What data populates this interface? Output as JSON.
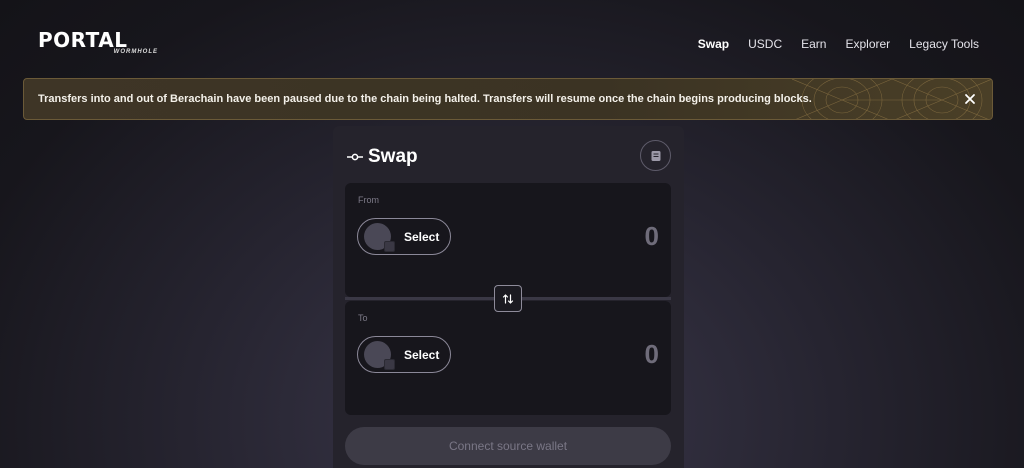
{
  "header": {
    "logo": {
      "name": "PORTAL",
      "sub": "WORMHOLE"
    },
    "nav": [
      {
        "label": "Swap",
        "active": true
      },
      {
        "label": "USDC",
        "active": false
      },
      {
        "label": "Earn",
        "active": false
      },
      {
        "label": "Explorer",
        "active": false
      },
      {
        "label": "Legacy Tools",
        "active": false
      }
    ]
  },
  "banner": {
    "message": "Transfers into and out of Berachain have been paused due to the chain being halted. Transfers will resume once the chain begins producing blocks.",
    "close_icon": "close-icon"
  },
  "swap_card": {
    "title": "Swap",
    "title_icon": "swap-commit-icon",
    "history_icon": "history-icon",
    "from": {
      "label": "From",
      "select_label": "Select",
      "amount": "0"
    },
    "to": {
      "label": "To",
      "select_label": "Select",
      "amount": "0"
    },
    "flip_icon": "swap-arrows-icon",
    "connect_button": "Connect source wallet"
  },
  "colors": {
    "banner_bg": "#3e3526",
    "banner_border": "#6b5a38",
    "card_bg": "#25232c",
    "panel_bg": "#17161c"
  }
}
